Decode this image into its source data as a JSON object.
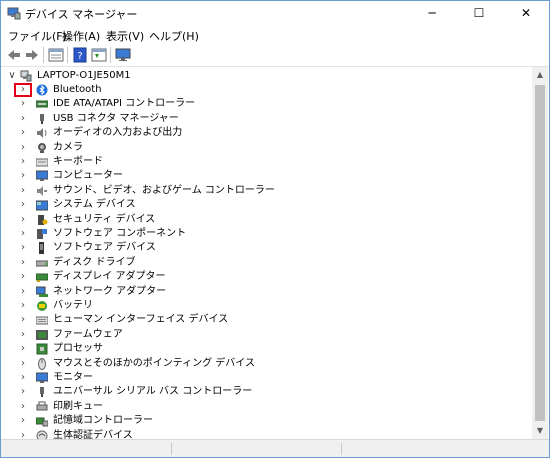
{
  "window": {
    "title": "デバイス マネージャー",
    "minimize": "─",
    "maximize": "☐",
    "close": "✕"
  },
  "menu": [
    {
      "label": "ファイル(F)"
    },
    {
      "label": "操作(A)"
    },
    {
      "label": "表示(V)"
    },
    {
      "label": "ヘルプ(H)"
    }
  ],
  "toolbar": {
    "icons": [
      "back-arrow-icon",
      "forward-arrow-icon",
      "properties-icon",
      "help-icon",
      "details-icon",
      "monitor-icon"
    ]
  },
  "tree": {
    "root": {
      "label": "LAPTOP-O1JE50M1",
      "expander": "∨",
      "icon": "computer-icon"
    },
    "highlight_color": "#e6001a",
    "items": [
      {
        "label": "Bluetooth",
        "icon": "bluetooth-icon"
      },
      {
        "label": "IDE ATA/ATAPI コントローラー",
        "icon": "ide-controller-icon"
      },
      {
        "label": "USB コネクタ マネージャー",
        "icon": "usb-connector-icon"
      },
      {
        "label": "オーディオの入力および出力",
        "icon": "speaker-icon"
      },
      {
        "label": "カメラ",
        "icon": "camera-icon"
      },
      {
        "label": "キーボード",
        "icon": "keyboard-icon"
      },
      {
        "label": "コンピューター",
        "icon": "computer-monitor-icon"
      },
      {
        "label": "サウンド、ビデオ、およびゲーム コントローラー",
        "icon": "sound-icon"
      },
      {
        "label": "システム デバイス",
        "icon": "system-device-icon"
      },
      {
        "label": "セキュリティ デバイス",
        "icon": "security-device-icon"
      },
      {
        "label": "ソフトウェア コンポーネント",
        "icon": "software-component-icon"
      },
      {
        "label": "ソフトウェア デバイス",
        "icon": "software-device-icon"
      },
      {
        "label": "ディスク ドライブ",
        "icon": "disk-drive-icon"
      },
      {
        "label": "ディスプレイ アダプター",
        "icon": "display-adapter-icon"
      },
      {
        "label": "ネットワーク アダプター",
        "icon": "network-adapter-icon"
      },
      {
        "label": "バッテリ",
        "icon": "battery-icon"
      },
      {
        "label": "ヒューマン インターフェイス デバイス",
        "icon": "hid-icon"
      },
      {
        "label": "ファームウェア",
        "icon": "firmware-icon"
      },
      {
        "label": "プロセッサ",
        "icon": "processor-icon"
      },
      {
        "label": "マウスとそのほかのポインティング デバイス",
        "icon": "mouse-icon"
      },
      {
        "label": "モニター",
        "icon": "monitor-icon"
      },
      {
        "label": "ユニバーサル シリアル バス コントローラー",
        "icon": "usb-controller-icon"
      },
      {
        "label": "印刷キュー",
        "icon": "print-queue-icon"
      },
      {
        "label": "記憶域コントローラー",
        "icon": "storage-controller-icon"
      },
      {
        "label": "生体認証デバイス",
        "icon": "biometric-icon"
      }
    ],
    "expander": "›"
  }
}
